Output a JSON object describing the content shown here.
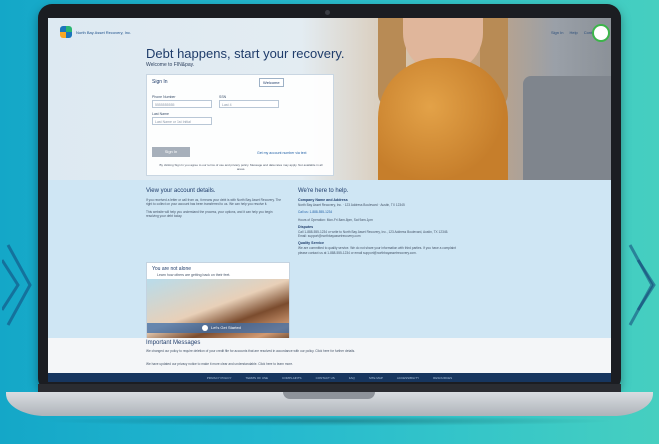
{
  "colors": {
    "background_left": "#14a7c8",
    "background_right": "#46cfc0",
    "brand_navy": "#1f3c6a",
    "brand_green": "#3cb54a"
  },
  "header": {
    "logo_text": "North Bay Asset Recovery, Inc.",
    "nav": [
      "Sign In",
      "Help",
      "Contact Us"
    ]
  },
  "hero": {
    "headline": "Debt happens, start your recovery.",
    "welcome": "Welcome to FIN&pay."
  },
  "signin": {
    "title": "Sign In",
    "new_user_label": "Welcome",
    "phone_label": "Phone Number",
    "phone_placeholder": "5555555555",
    "ssn_label": "SSN",
    "ssn_placeholder": "Last 4",
    "lastname_label": "Last Name",
    "lastname_placeholder": "Last Name or 1st Initial",
    "signin_button": "Sign In",
    "forgot_link": "Get my account number via text",
    "legal_text": "By clicking Sign In you agree to our terms of use and privacy policy. Message and data rates may apply. Not available in all areas."
  },
  "details": {
    "title": "View your account details.",
    "p1": "If you received a letter or call from us, it means your debt is with North Bay Asset Recovery. The right to collect on your account has been transferred to us. We can help you resolve it.",
    "p2": "This website will help you understand the process, your options, and it can help you begin resolving your debt today."
  },
  "help": {
    "title": "We're here to help.",
    "company_title": "Company Name and Address",
    "company_text": "North Bay Asset Recovery, Inc. · 123 Address Boulevard · Austin, TX 12345",
    "phone_text": "Call us: 1-888-555-1234",
    "hours_text": "Hours of Operation: Mon-Fri 8am-8pm, Sat 9am-1pm",
    "disputes_title": "Disputes",
    "disputes_text": "Call 1-888-555-1234 or write to North Bay Asset Recovery, Inc., 123 Address Boulevard, Austin, TX 12345. Email: support@northbayassetrecovery.com",
    "quality_title": "Quality Service",
    "quality_text": "We are committed to quality service. We do not share your information with third parties. If you have a complaint please contact us at 1-888-555-1234 or email support@northbayassetrecovery.com."
  },
  "video": {
    "title": "You are not alone",
    "subtitle": "Learn how others are getting back on their feet.",
    "button": "Let's Get Started"
  },
  "messages": {
    "title": "Important Messages",
    "m1": "We changed our policy to require deletion of your credit file for accounts that are resolved in accordance with our policy. Click here for further details.",
    "m2": "We have updated our privacy notice to make it more clear and understandable. Click here to learn more."
  },
  "footer": {
    "links": [
      "PRIVACY POLICY",
      "TERMS OF USE",
      "COMPLAINTS",
      "CONTACT US",
      "FAQ",
      "SITE MAP",
      "ACCESSIBILITY",
      "RESOURCES"
    ]
  }
}
